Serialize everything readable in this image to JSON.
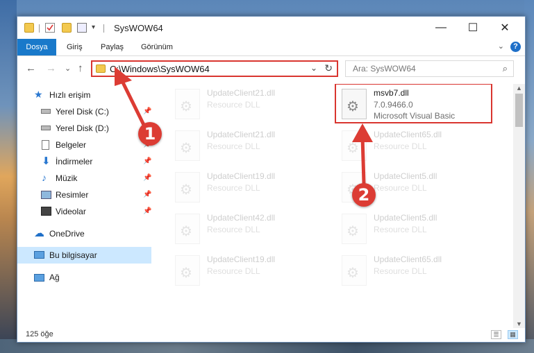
{
  "window": {
    "title": "SysWOW64",
    "minimize_glyph": "—",
    "maximize_glyph": "☐",
    "close_glyph": "✕"
  },
  "ribbon": {
    "tabs": [
      "Dosya",
      "Giriş",
      "Paylaş",
      "Görünüm"
    ],
    "expand_glyph": "⌄",
    "help_glyph": "?"
  },
  "navigation": {
    "back_glyph": "←",
    "forward_glyph": "→",
    "recent_glyph": "⌄",
    "up_glyph": "↑",
    "address": "C:\\Windows\\SysWOW64",
    "address_dropdown_glyph": "⌄",
    "refresh_glyph": "↻",
    "search_placeholder": "Ara: SysWOW64",
    "search_glyph": "⌕"
  },
  "sidebar": {
    "quick_access": "Hızlı erişim",
    "items": [
      {
        "label": "Yerel Disk (C:)",
        "icon": "drive-icon"
      },
      {
        "label": "Yerel Disk (D:)",
        "icon": "drive-icon"
      },
      {
        "label": "Belgeler",
        "icon": "documents-icon"
      },
      {
        "label": "İndirmeler",
        "icon": "downloads-icon"
      },
      {
        "label": "Müzik",
        "icon": "music-icon"
      },
      {
        "label": "Resimler",
        "icon": "pictures-icon"
      },
      {
        "label": "Videolar",
        "icon": "videos-icon"
      }
    ],
    "onedrive": "OneDrive",
    "this_pc": "Bu bilgisayar",
    "network": "Ağ"
  },
  "files": {
    "left_column": [
      {
        "name": "UpdateClient21.dll",
        "type": "Resource DLL"
      },
      {
        "name": "UpdateClient21.dll",
        "type": "Resource DLL"
      },
      {
        "name": "UpdateClient19.dll",
        "type": "Resource DLL"
      },
      {
        "name": "UpdateClient42.dll",
        "type": "Resource DLL"
      },
      {
        "name": "UpdateClient19.dll",
        "type": "Resource DLL"
      }
    ],
    "right_column": [
      {
        "name": "msvb7.dll",
        "version": "7.0.9466.0",
        "description": "Microsoft Visual Basic"
      },
      {
        "name": "UpdateClient65.dll",
        "type": "Resource DLL"
      },
      {
        "name": "UpdateClient5.dll",
        "type": "Resource DLL"
      },
      {
        "name": "UpdateClient5.dll",
        "type": "Resource DLL"
      },
      {
        "name": "UpdateClient65.dll",
        "type": "Resource DLL"
      }
    ]
  },
  "status": {
    "item_count": "125 öğe"
  },
  "callouts": [
    "1",
    "2"
  ],
  "colors": {
    "accent": "#1979ca",
    "highlight": "#d9352f",
    "selection": "#cce8ff"
  }
}
